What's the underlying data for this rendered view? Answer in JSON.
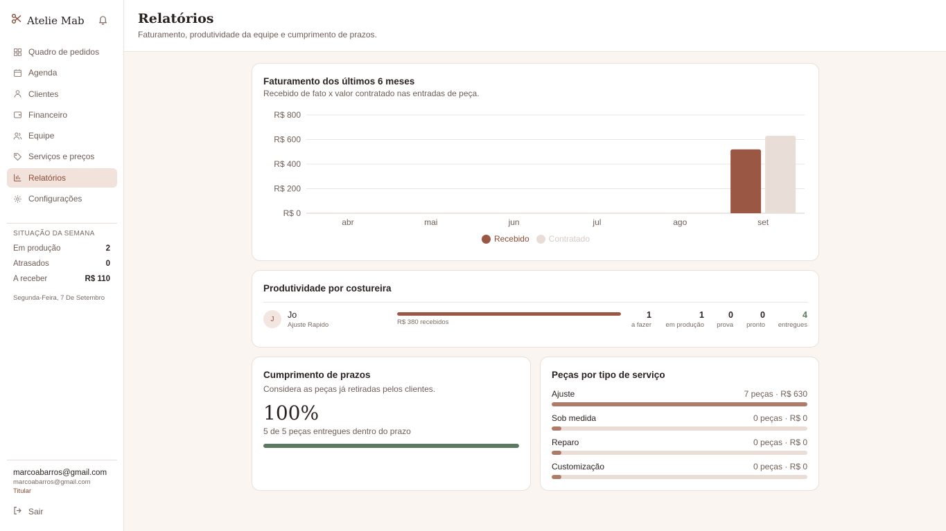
{
  "app": {
    "name": "Atelie Mab"
  },
  "nav": [
    {
      "label": "Quadro de pedidos",
      "icon": "grid-icon",
      "active": false
    },
    {
      "label": "Agenda",
      "icon": "calendar-icon",
      "active": false
    },
    {
      "label": "Clientes",
      "icon": "user-icon",
      "active": false
    },
    {
      "label": "Financeiro",
      "icon": "wallet-icon",
      "active": false
    },
    {
      "label": "Equipe",
      "icon": "users-icon",
      "active": false
    },
    {
      "label": "Serviços e preços",
      "icon": "tag-icon",
      "active": false
    },
    {
      "label": "Relatórios",
      "icon": "bar-chart-icon",
      "active": true
    },
    {
      "label": "Configurações",
      "icon": "gear-icon",
      "active": false
    }
  ],
  "week": {
    "title": "SITUAÇÃO DA SEMANA",
    "rows": [
      {
        "label": "Em produção",
        "value": "2"
      },
      {
        "label": "Atrasados",
        "value": "0"
      },
      {
        "label": "A receber",
        "value": "R$ 110"
      }
    ],
    "date": "Segunda-Feira, 7 De Setembro"
  },
  "user": {
    "name": "marcoabarros@gmail.com",
    "email": "marcoabarros@gmail.com",
    "role": "Titular",
    "logout_label": "Sair"
  },
  "header": {
    "title": "Relatórios",
    "subtitle": "Faturamento, produtividade da equipe e cumprimento de prazos."
  },
  "revenue_card": {
    "title": "Faturamento dos últimos 6 meses",
    "subtitle": "Recebido de fato x valor contratado nas entradas de peça."
  },
  "chart_data": {
    "type": "bar",
    "categories": [
      "abr",
      "mai",
      "jun",
      "jul",
      "ago",
      "set"
    ],
    "series": [
      {
        "name": "Recebido",
        "values": [
          0,
          0,
          0,
          0,
          0,
          520
        ],
        "color": "#9a5844"
      },
      {
        "name": "Contratado",
        "values": [
          0,
          0,
          0,
          0,
          0,
          630
        ],
        "color": "#e8ddd7"
      }
    ],
    "y_ticks": [
      "R$ 0",
      "R$ 200",
      "R$ 400",
      "R$ 600",
      "R$ 800"
    ],
    "ylim": [
      0,
      800
    ],
    "grid": true,
    "legend": "bottom-center"
  },
  "productivity": {
    "title": "Produtividade por costureira",
    "employees": [
      {
        "initial": "J",
        "name": "Jo",
        "role": "Ajuste Rapido",
        "received_label": "R$ 380 recebidos",
        "received_fraction": 1.0,
        "stats": [
          {
            "value": "1",
            "label": "a fazer"
          },
          {
            "value": "1",
            "label": "em produção"
          },
          {
            "value": "0",
            "label": "prova"
          },
          {
            "value": "0",
            "label": "pronto"
          },
          {
            "value": "4",
            "label": "entregues"
          }
        ]
      }
    ]
  },
  "deadlines": {
    "title": "Cumprimento de prazos",
    "subtitle": "Considera as peças já retiradas pelos clientes.",
    "percent_label": "100%",
    "percent": 100,
    "note": "5 de 5 peças entregues dentro do prazo"
  },
  "services": {
    "title": "Peças por tipo de serviço",
    "items": [
      {
        "name": "Ajuste",
        "value_label": "7 peças · R$ 630",
        "fraction": 1.0
      },
      {
        "name": "Sob medida",
        "value_label": "0 peças · R$ 0",
        "fraction": 0
      },
      {
        "name": "Reparo",
        "value_label": "0 peças · R$ 0",
        "fraction": 0
      },
      {
        "name": "Customização",
        "value_label": "0 peças · R$ 0",
        "fraction": 0
      }
    ]
  },
  "colors": {
    "accent": "#9a5844",
    "accent_light": "#e8ddd7",
    "success": "#5a7a62",
    "active_bg": "#f1e3dc",
    "page_bg": "#faf5f1"
  }
}
